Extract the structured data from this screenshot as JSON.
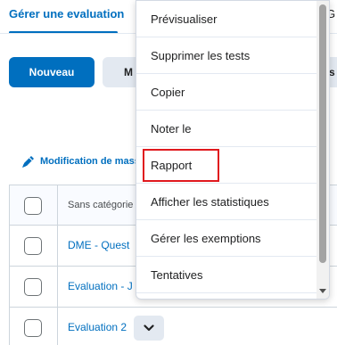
{
  "tabs": {
    "active": "Gérer une evaluation",
    "right_partial": "G"
  },
  "toolbar": {
    "new_label": "Nouveau",
    "more_label": "M",
    "right_partial": "s"
  },
  "bulk_edit": {
    "label": "Modification de mass"
  },
  "table": {
    "header": "Sans catégorie",
    "rows": [
      {
        "label": "DME - Quest"
      },
      {
        "label": "Evaluation - J"
      },
      {
        "label": "Evaluation 2"
      }
    ]
  },
  "menu": {
    "items": [
      {
        "label": "Prévisualiser"
      },
      {
        "label": "Supprimer les tests"
      },
      {
        "label": "Copier"
      },
      {
        "label": "Noter le"
      },
      {
        "label": "Rapport",
        "highlighted": true
      },
      {
        "label": "Afficher les statistiques"
      },
      {
        "label": "Gérer les exemptions"
      },
      {
        "label": "Tentatives"
      }
    ]
  },
  "colors": {
    "accent": "#006fbf",
    "highlight": "#e0191e",
    "button_secondary": "#e3e9f1"
  }
}
